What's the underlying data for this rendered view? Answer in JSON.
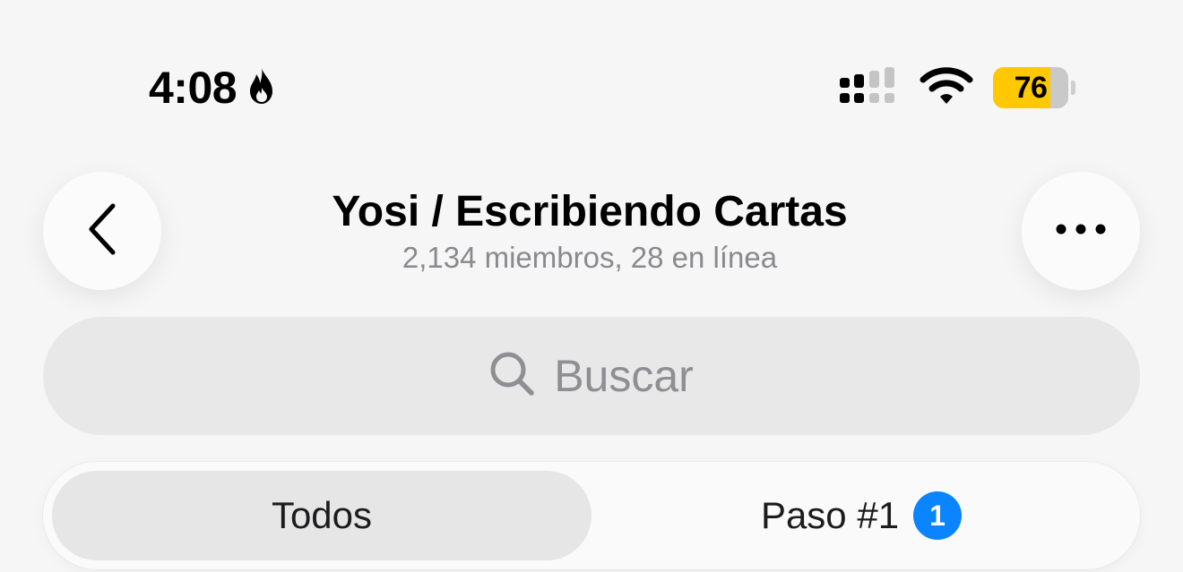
{
  "status_bar": {
    "time": "4:08",
    "battery_level": "76",
    "battery_fraction": 0.76,
    "icons": [
      "flame-icon",
      "cellular-signal-icon",
      "wifi-icon",
      "battery-icon"
    ]
  },
  "header": {
    "title": "Yosi / Escribiendo Cartas",
    "subtitle": "2,134 miembros, 28 en línea",
    "back_icon": "chevron-left-icon",
    "more_icon": "ellipsis-icon"
  },
  "search": {
    "placeholder": "Buscar",
    "icon": "search-icon"
  },
  "tabs": [
    {
      "label": "Todos",
      "selected": true
    },
    {
      "label": "Paso #1",
      "badge": "1",
      "selected": false
    }
  ],
  "colors": {
    "background": "#f6f6f6",
    "battery_fill": "#ffc800",
    "badge": "#0a84ff",
    "search_bg": "#e8e8e8",
    "subtitle": "#8a8a8e"
  }
}
